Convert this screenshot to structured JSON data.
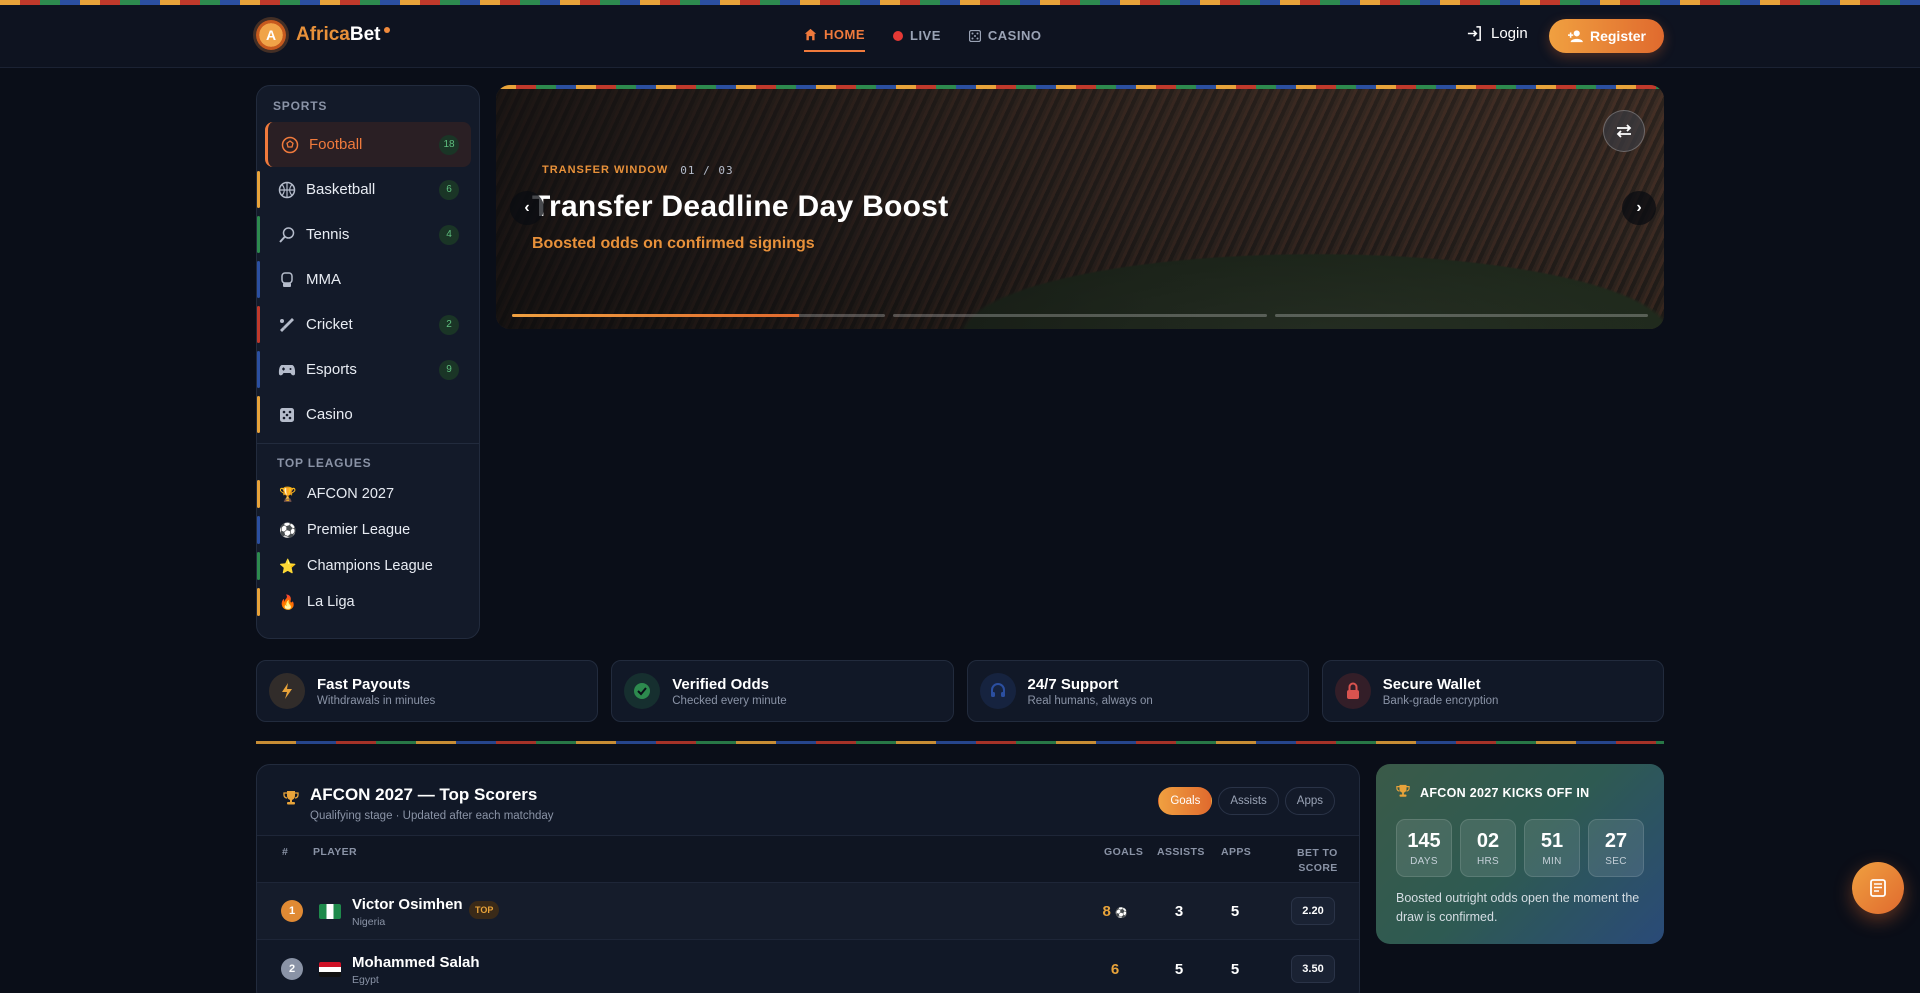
{
  "brand": {
    "name_part1": "Africa",
    "name_part2": "Bet",
    "badge_letter": "A"
  },
  "nav": [
    {
      "label": "HOME",
      "icon": "home-icon",
      "active": true
    },
    {
      "label": "LIVE",
      "icon": "live-dot-icon",
      "active": false
    },
    {
      "label": "CASINO",
      "icon": "casino-icon",
      "active": false
    }
  ],
  "auth": {
    "login_label": "Login",
    "register_label": "Register"
  },
  "sidebar": {
    "sports_heading": "SPORTS",
    "sports": [
      {
        "label": "Football",
        "count": "18",
        "icon": "football-icon",
        "active": true
      },
      {
        "label": "Basketball",
        "count": "6",
        "icon": "basketball-icon"
      },
      {
        "label": "Tennis",
        "count": "4",
        "icon": "tennis-icon"
      },
      {
        "label": "MMA",
        "count": "",
        "icon": "glove-icon"
      },
      {
        "label": "Cricket",
        "count": "2",
        "icon": "cricket-icon"
      },
      {
        "label": "Esports",
        "count": "9",
        "icon": "gamepad-icon"
      },
      {
        "label": "Casino",
        "count": "",
        "icon": "dice-icon"
      }
    ],
    "leagues_heading": "TOP LEAGUES",
    "leagues": [
      {
        "label": "AFCON 2027",
        "icon": "trophy-icon",
        "glyph": "🏆"
      },
      {
        "label": "Premier League",
        "icon": "soccer-ball-icon",
        "glyph": "⚽"
      },
      {
        "label": "Champions League",
        "icon": "star-icon",
        "glyph": "⭐"
      },
      {
        "label": "La Liga",
        "icon": "fire-icon",
        "glyph": "🔥"
      }
    ]
  },
  "hero": {
    "tag": "TRANSFER WINDOW",
    "index": "01 / 03",
    "title": "Transfer Deadline Day Boost",
    "subtitle": "Boosted odds on confirmed signings",
    "progress": [
      0.77,
      0,
      0
    ]
  },
  "features": [
    {
      "title": "Fast Payouts",
      "subtitle": "Withdrawals in minutes",
      "icon": "lightning-icon",
      "color": "#e8a33a"
    },
    {
      "title": "Verified Odds",
      "subtitle": "Checked every minute",
      "icon": "verified-icon",
      "color": "#2d8a4e"
    },
    {
      "title": "24/7 Support",
      "subtitle": "Real humans, always on",
      "icon": "headset-icon",
      "color": "#2b4fa0"
    },
    {
      "title": "Secure Wallet",
      "subtitle": "Bank-grade encryption",
      "icon": "lock-icon",
      "color": "#c0392b"
    }
  ],
  "scorers": {
    "title": "AFCON 2027 — Top Scorers",
    "subtitle": "Qualifying stage · Updated after each matchday",
    "tabs": [
      {
        "label": "Goals",
        "active": true
      },
      {
        "label": "Assists"
      },
      {
        "label": "Apps"
      }
    ],
    "columns": {
      "rank": "#",
      "player": "PLAYER",
      "goals": "GOALS",
      "assists": "ASSISTS",
      "apps": "APPS",
      "bet_line1": "BET TO",
      "bet_line2": "SCORE"
    },
    "rows": [
      {
        "rank": "1",
        "name": "Victor Osimhen",
        "country": "Nigeria",
        "badge": "TOP",
        "goals": "8",
        "assists": "3",
        "apps": "5",
        "odds": "2.20"
      },
      {
        "rank": "2",
        "name": "Mohammed Salah",
        "country": "Egypt",
        "badge": "",
        "goals": "6",
        "assists": "5",
        "apps": "5",
        "odds": "3.50"
      }
    ]
  },
  "kickoff": {
    "title": "AFCON 2027 KICKS OFF IN",
    "days": "145",
    "days_label": "DAYS",
    "hrs": "02",
    "hrs_label": "HRS",
    "min": "51",
    "min_label": "MIN",
    "sec": "27",
    "sec_label": "SEC",
    "note": "Boosted outright odds open the moment the draw is confirmed."
  }
}
